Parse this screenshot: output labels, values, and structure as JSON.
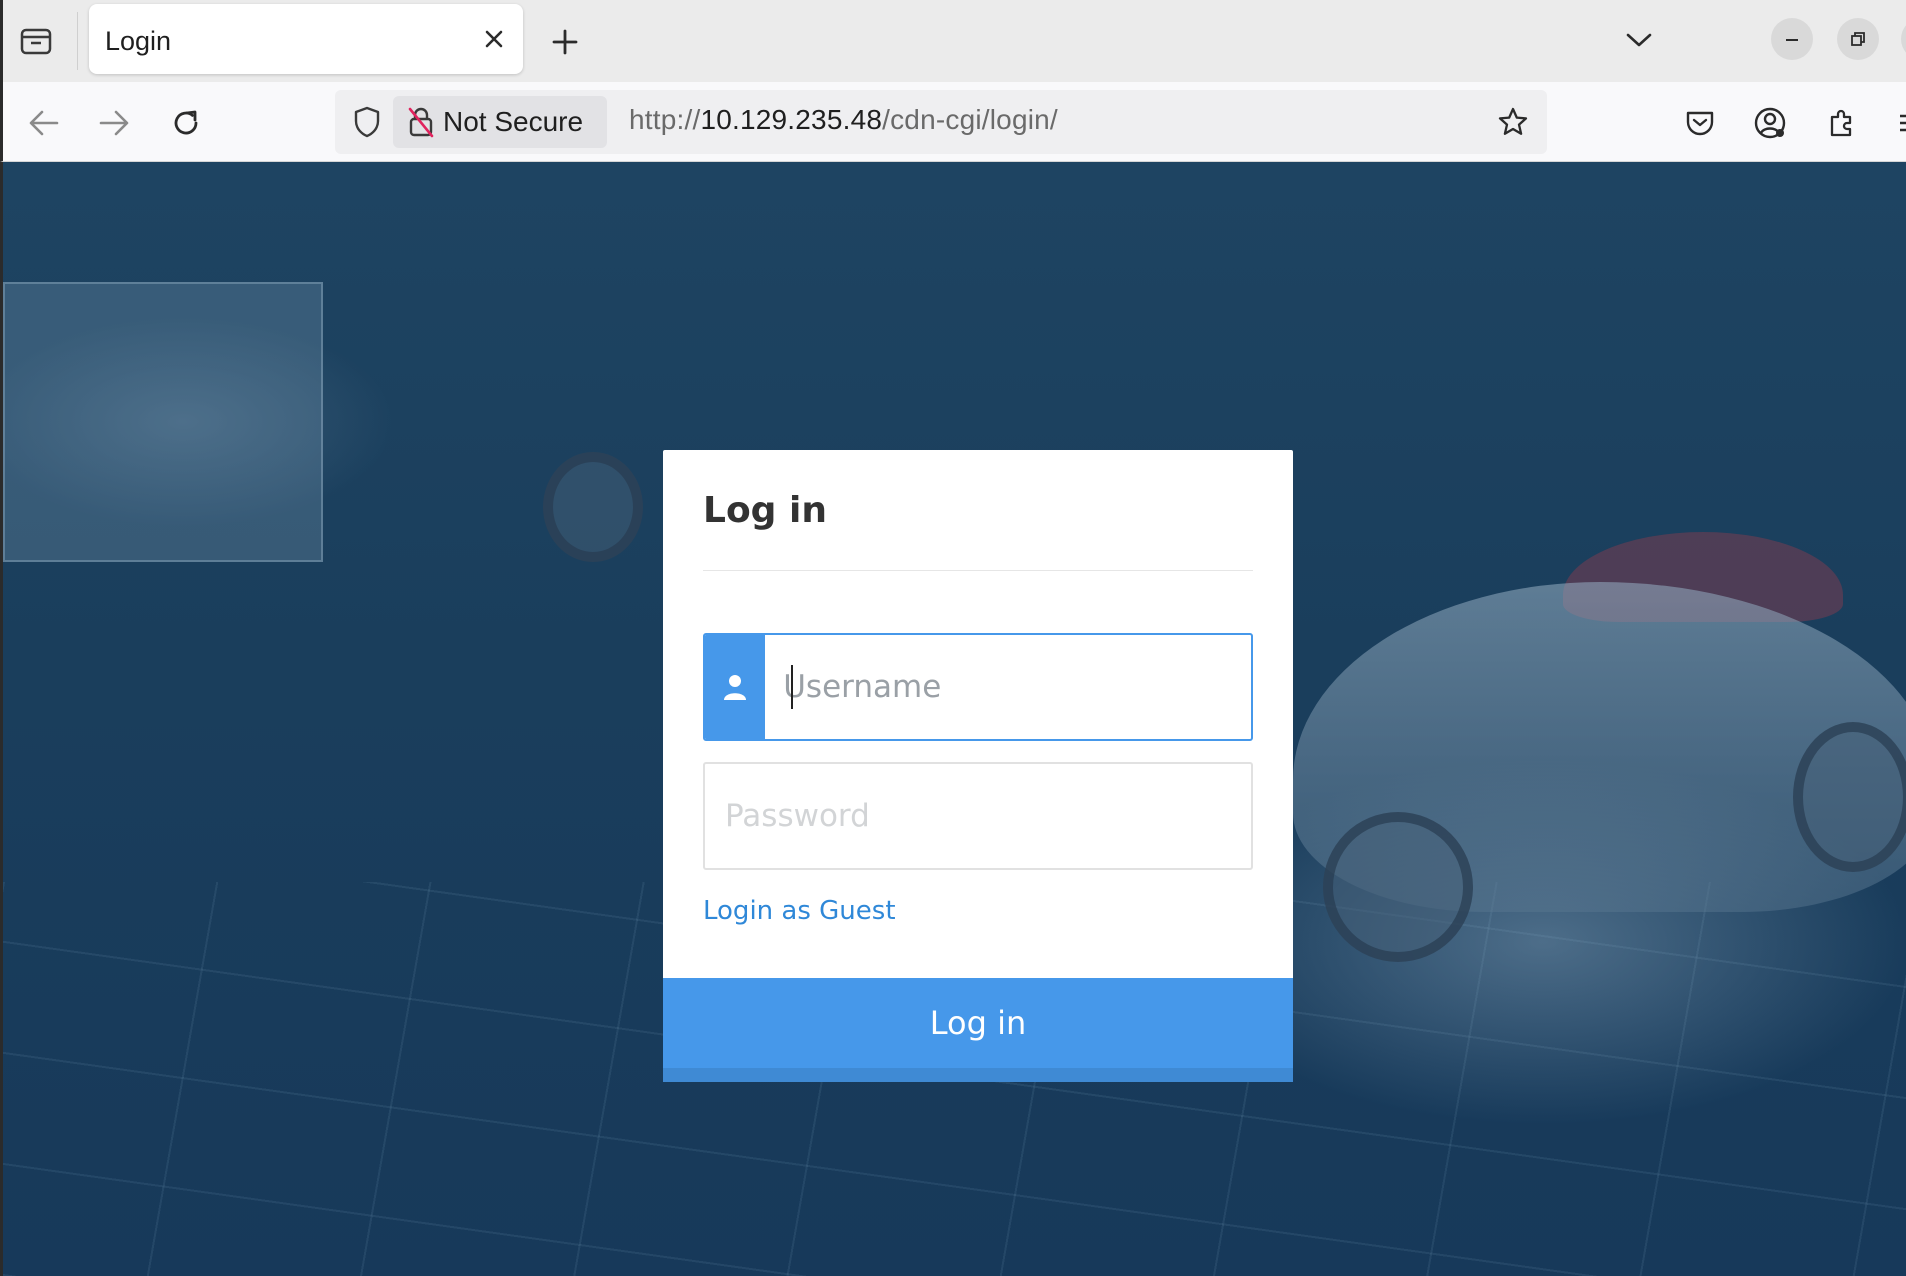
{
  "browser": {
    "tab": {
      "title": "Login"
    },
    "address": {
      "security_label": "Not Secure",
      "url_scheme": "http://",
      "url_host": "10.129.235.48",
      "url_path": "/cdn-cgi/login/"
    },
    "icons": {
      "tab_list": "tab-list-icon",
      "close_tab": "close-icon",
      "new_tab": "plus-icon",
      "list_all_tabs": "chevron-down-icon",
      "minimize": "minimize-icon",
      "restore": "restore-icon",
      "back": "arrow-left-icon",
      "forward": "arrow-right-icon",
      "reload": "reload-icon",
      "tracking_protection": "shield-icon",
      "insecure": "broken-lock-icon",
      "bookmark": "star-icon",
      "pocket": "pocket-icon",
      "account": "account-icon",
      "extensions": "puzzle-icon",
      "menu": "hamburger-icon"
    }
  },
  "login": {
    "title": "Log in",
    "username_placeholder": "Username",
    "password_placeholder": "Password",
    "guest_link": "Login as Guest",
    "submit_label": "Log in"
  },
  "colors": {
    "primary": "#4698ea",
    "link": "#2f88d8",
    "background": "#1a3e5c"
  }
}
